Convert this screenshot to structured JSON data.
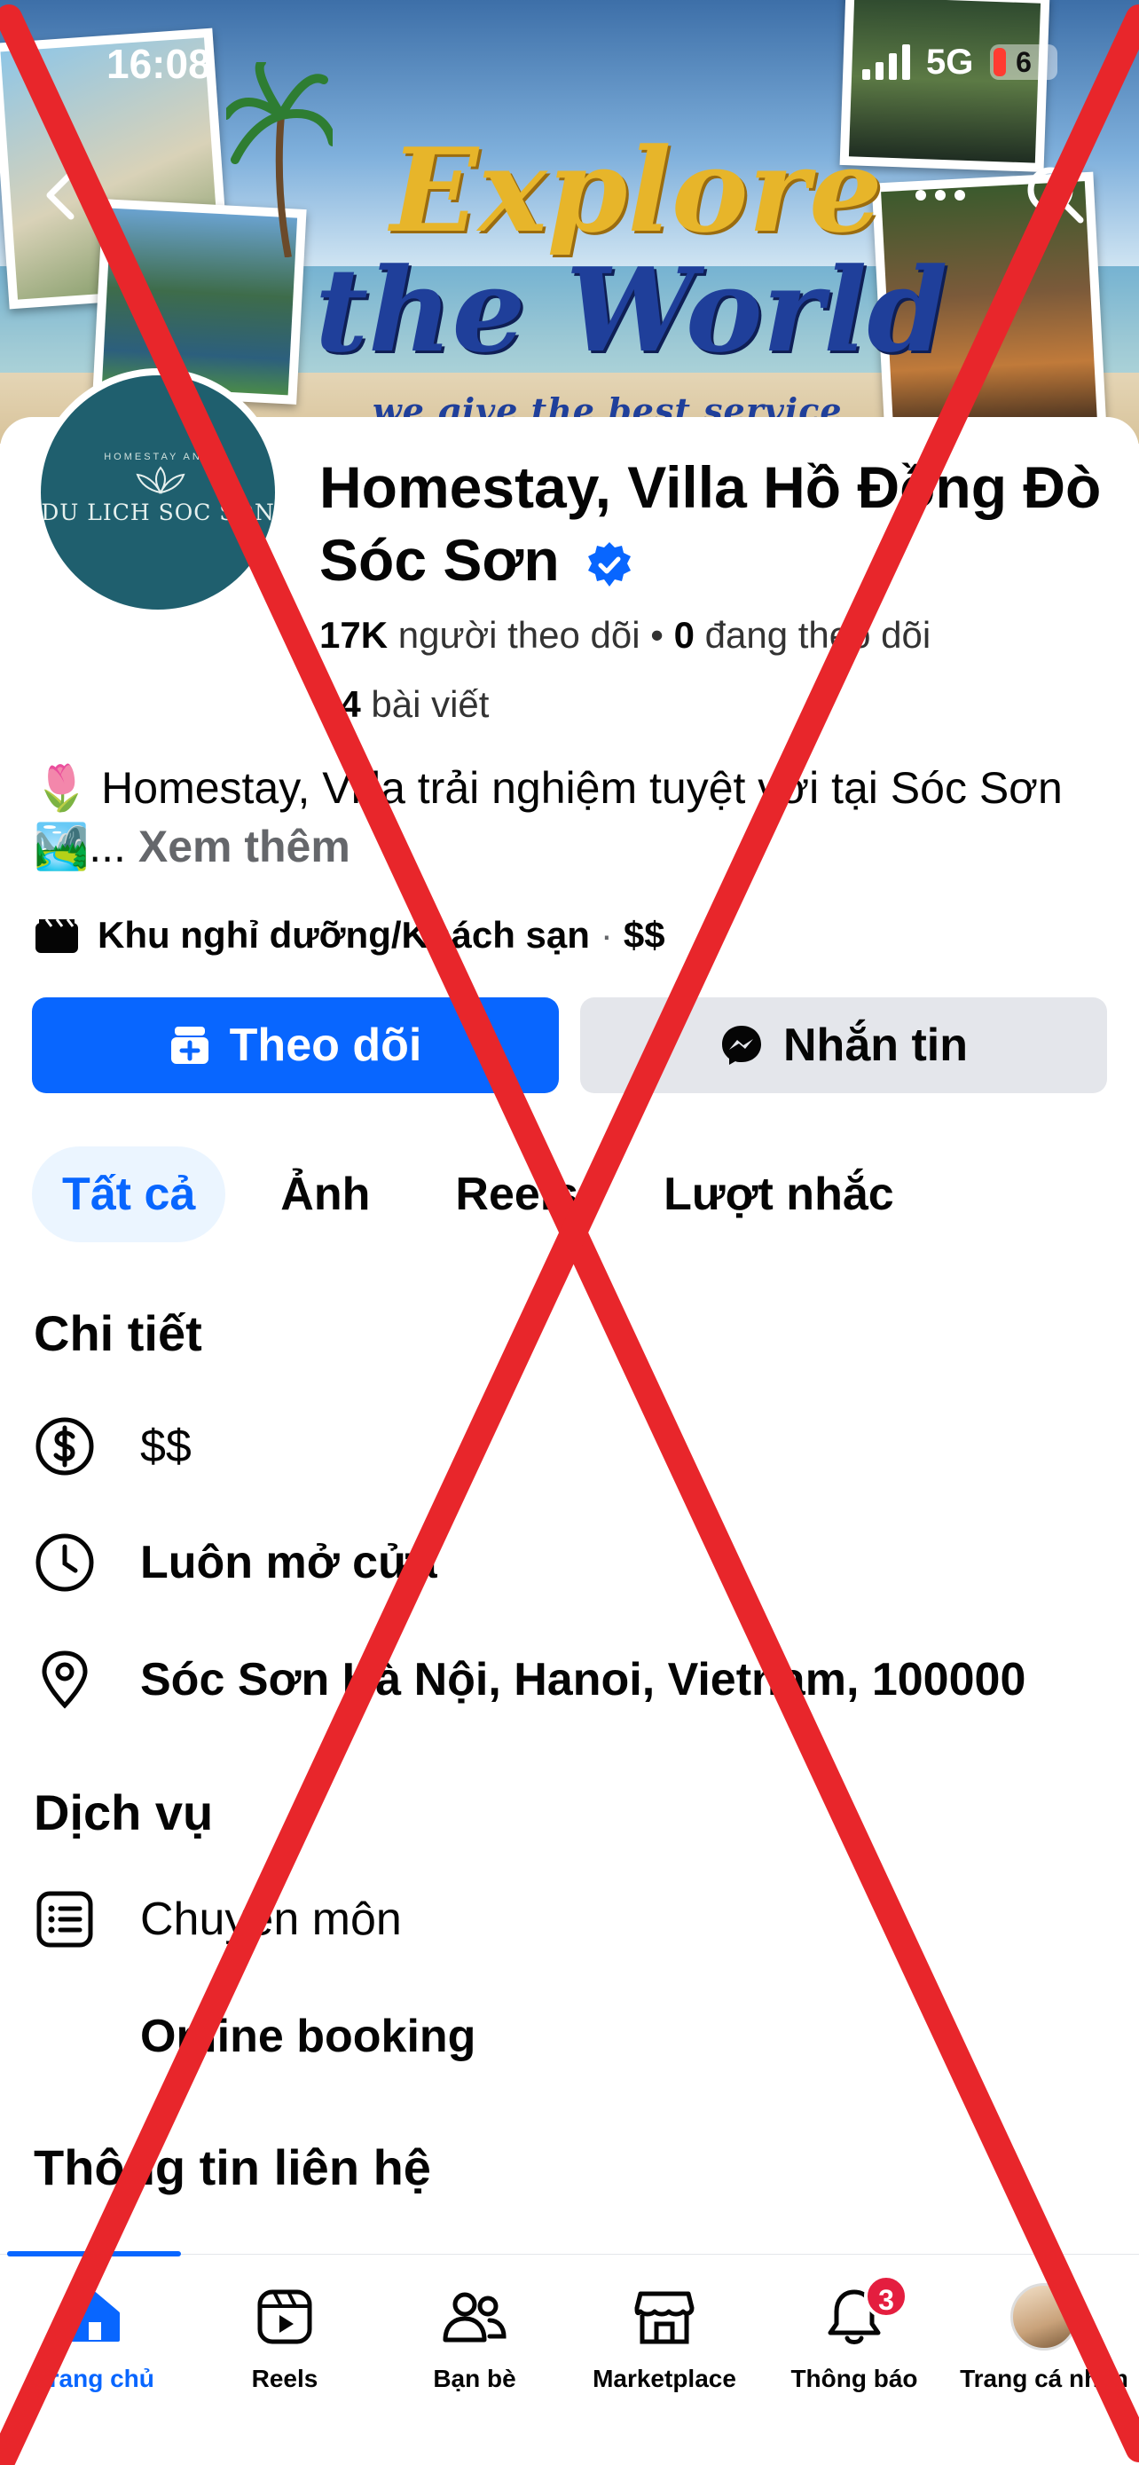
{
  "status_bar": {
    "time": "16:08",
    "network": "5G",
    "battery": "6"
  },
  "cover": {
    "headline_1": "Explore",
    "headline_2": "the World",
    "slogan": "we give the best service"
  },
  "profile": {
    "avatar_text": "DU LICH SOC SON",
    "avatar_subtext": "HOMESTAY AND",
    "name": "Homestay, Villa Hồ Đồng Đò Sóc Sơn",
    "followers_count": "17K",
    "followers_label": " người theo dõi • ",
    "following_count": "0",
    "following_label": " đang theo dõi",
    "posts_count": "24",
    "posts_label": " bài viết"
  },
  "bio": {
    "emoji_start": "🌷",
    "text": " Homestay, Villa trải nghiệm tuyệt vời tại Sóc Sơn ",
    "emoji_end": "🏞️",
    "ellipsis": "... ",
    "more": "Xem thêm"
  },
  "category": {
    "label": "Khu nghỉ dưỡng/Khách sạn",
    "separator": "·",
    "price": "$$"
  },
  "actions": {
    "follow": "Theo dõi",
    "message": "Nhắn tin"
  },
  "tabs": [
    {
      "label": "Tất cả",
      "active": true
    },
    {
      "label": "Ảnh",
      "active": false
    },
    {
      "label": "Reels",
      "active": false
    },
    {
      "label": "Lượt nhắc",
      "active": false
    }
  ],
  "details": {
    "title": "Chi tiết",
    "price": "$$",
    "hours": "Luôn mở cửa",
    "address": "Sóc Sơn Hà Nội, Hanoi, Vietnam, 100000"
  },
  "services": {
    "title": "Dịch vụ",
    "item_1": "Chuyên môn",
    "item_2": "Online booking"
  },
  "contact": {
    "title": "Thông tin liên hệ"
  },
  "bottom_nav": [
    {
      "label": "Trang chủ",
      "icon": "home-icon",
      "active": true
    },
    {
      "label": "Reels",
      "icon": "reels-icon",
      "active": false
    },
    {
      "label": "Bạn bè",
      "icon": "friends-icon",
      "active": false
    },
    {
      "label": "Marketplace",
      "icon": "marketplace-icon",
      "active": false
    },
    {
      "label": "Thông báo",
      "icon": "bell-icon",
      "active": false,
      "badge": "3"
    },
    {
      "label": "Trang cá nhân",
      "icon": "profile-avatar",
      "active": false
    }
  ],
  "colors": {
    "accent": "#0866ff",
    "overlay_x": "#e8262b",
    "badge": "#e41e3f"
  }
}
